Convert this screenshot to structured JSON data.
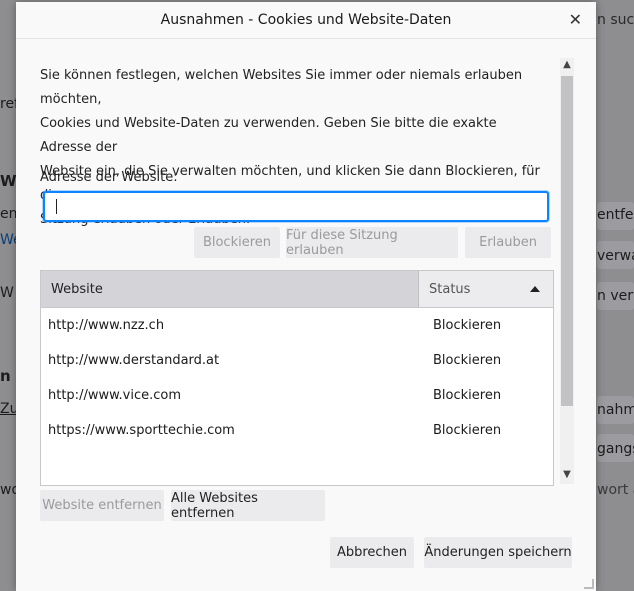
{
  "background": {
    "right_fragments": [
      "n suc",
      "entfe",
      "verwa",
      "n verw",
      "nahme",
      "gangsd",
      "wort ä"
    ],
    "left_fragments": [
      "refe",
      "We",
      "en ;",
      "We",
      "W",
      "n &",
      "Zug",
      "wo"
    ]
  },
  "dialog": {
    "title": "Ausnahmen - Cookies und Website-Daten",
    "close_glyph": "✕",
    "description_lines": [
      "Sie können festlegen, welchen Websites Sie immer oder niemals erlauben möchten,",
      "Cookies und Website-Daten zu verwenden. Geben Sie bitte die exakte Adresse der",
      "Website ein, die Sie verwalten möchten, und klicken Sie dann Blockieren, für diese",
      "Sitzung erlauben oder Erlauben."
    ],
    "address_label": "Adresse der Website:",
    "address_value": "",
    "buttons": {
      "block": "Blockieren",
      "session": "Für diese Sitzung erlauben",
      "allow": "Erlauben",
      "remove_site": "Website entfernen",
      "remove_all": "Alle Websites entfernen",
      "cancel": "Abbrechen",
      "save": "Änderungen speichern"
    },
    "table": {
      "columns": [
        "Website",
        "Status"
      ],
      "rows": [
        {
          "site": "http://www.nzz.ch",
          "status": "Blockieren"
        },
        {
          "site": "http://www.derstandard.at",
          "status": "Blockieren"
        },
        {
          "site": "http://www.vice.com",
          "status": "Blockieren"
        },
        {
          "site": "https://www.sporttechie.com",
          "status": "Blockieren"
        }
      ]
    }
  },
  "colors": {
    "accent": "#0a84ff",
    "overlay": "#8e8e91",
    "button_bg": "#ebebed",
    "header_selected": "#d4d4d8"
  }
}
